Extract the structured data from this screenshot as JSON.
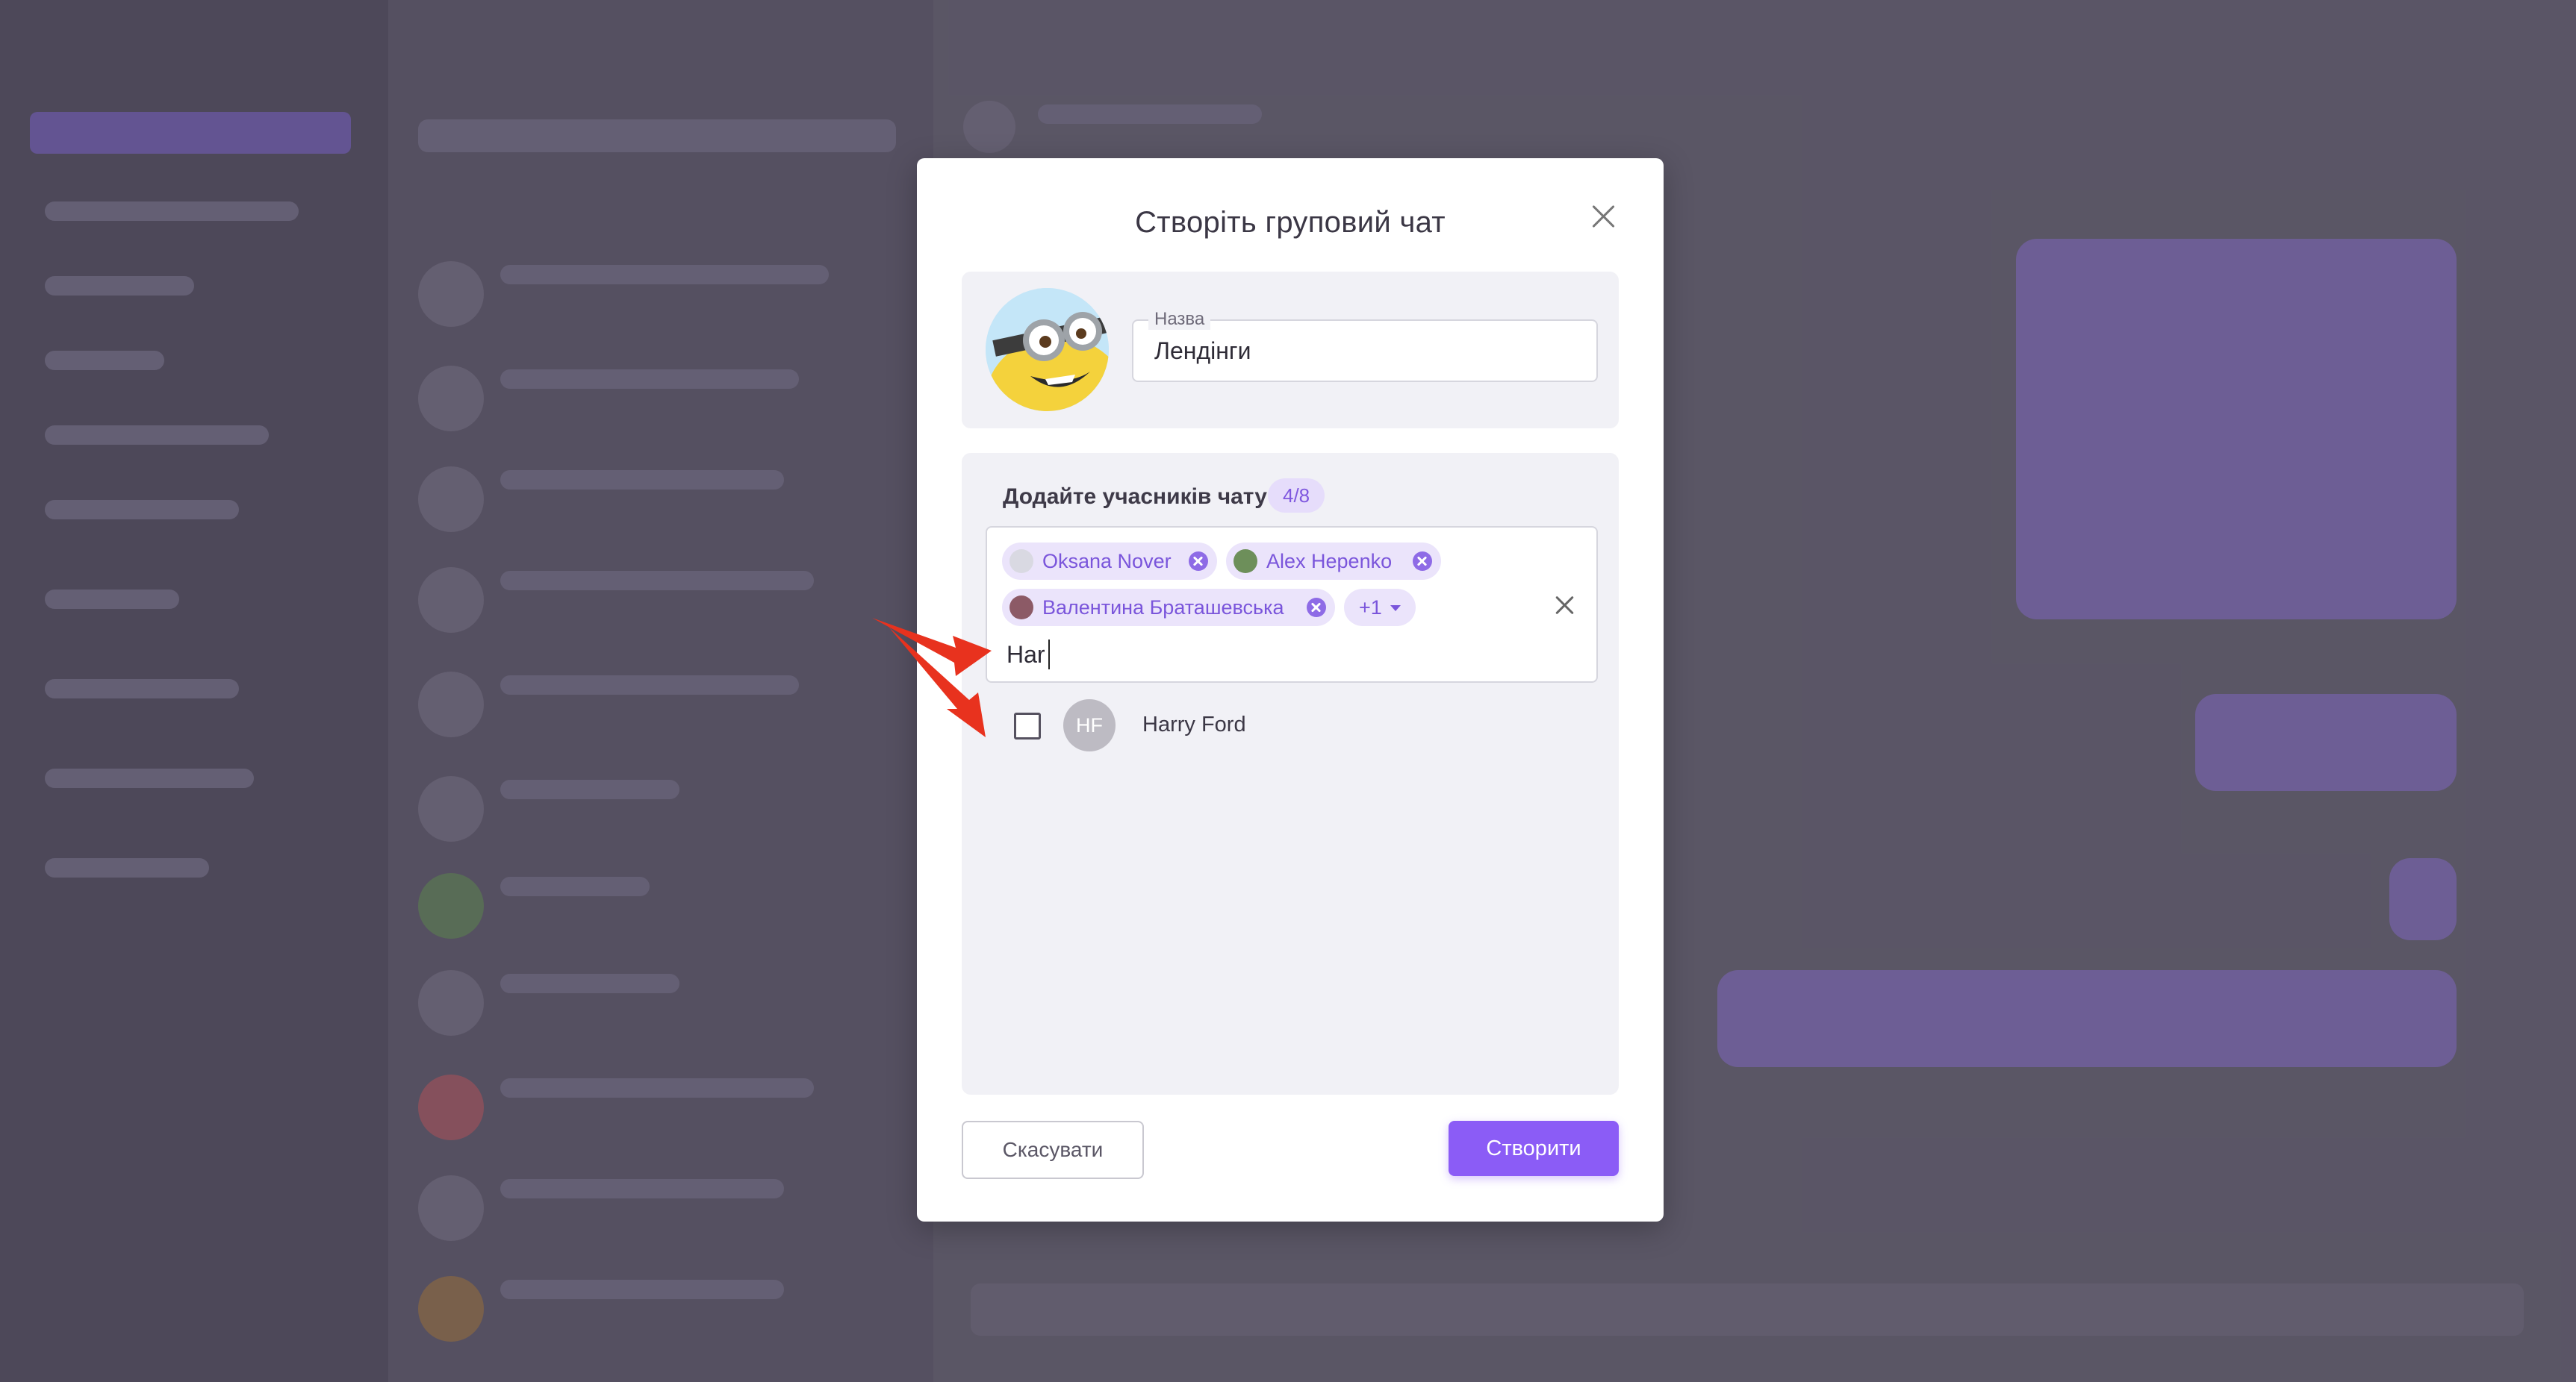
{
  "modal": {
    "title": "Створіть груповий чат",
    "name_label": "Назва",
    "name_value": "Лендінги",
    "members_label": "Додайте учасників чату",
    "members_count": "4/8",
    "chips": [
      {
        "name": "Oksana Nover",
        "avatar_color": "#cfcfd8"
      },
      {
        "name": "Alex Hepenko",
        "avatar_color": "#6d8f5a"
      },
      {
        "name": "Валентина Браташевська",
        "avatar_color": "#8c5a66"
      }
    ],
    "more_label": "+1",
    "search_value": "Har",
    "results": [
      {
        "initials": "HF",
        "name": "Harry Ford"
      }
    ],
    "cancel_label": "Скасувати",
    "create_label": "Створити"
  },
  "colors": {
    "accent": "#8b5cf6",
    "annotation_arrow": "#e8321e"
  }
}
